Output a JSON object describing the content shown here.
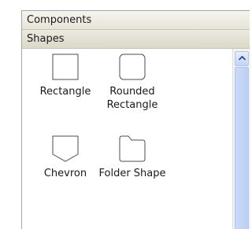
{
  "panel": {
    "headers": {
      "components": "Components",
      "shapes": "Shapes"
    },
    "shapes": [
      {
        "label_line1": "Rectangle",
        "label_line2": "",
        "icon": "rectangle-icon"
      },
      {
        "label_line1": "Rounded",
        "label_line2": "Rectangle",
        "icon": "rounded-rectangle-icon"
      },
      {
        "label_line1": "Chevron",
        "label_line2": "",
        "icon": "chevron-shape-icon"
      },
      {
        "label_line1": "Folder Shape",
        "label_line2": "",
        "icon": "folder-shape-icon"
      }
    ]
  },
  "scrollbar": {
    "up_icon": "chevron-up-icon"
  },
  "colors": {
    "header_bg": "#ece9d8",
    "scroll_accent": "#c4d4f6",
    "shape_stroke": "#4d4d4d"
  }
}
